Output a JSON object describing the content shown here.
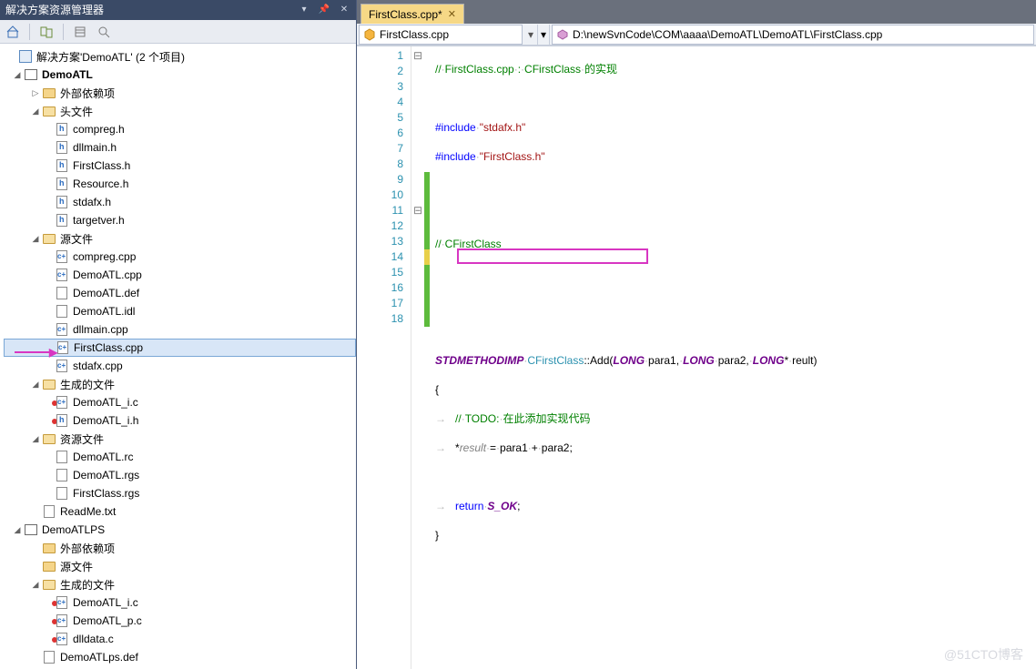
{
  "panelTitle": "解决方案资源管理器",
  "solution": "解决方案'DemoATL' (2 个项目)",
  "project1": "DemoATL",
  "p1_extdeps": "外部依赖项",
  "p1_headers": "头文件",
  "h_compreg": "compreg.h",
  "h_dllmain": "dllmain.h",
  "h_firstclass": "FirstClass.h",
  "h_resource": "Resource.h",
  "h_stdafx": "stdafx.h",
  "h_targetver": "targetver.h",
  "p1_sources": "源文件",
  "s_compreg": "compreg.cpp",
  "s_demoatl": "DemoATL.cpp",
  "s_demoatldef": "DemoATL.def",
  "s_demoatlidl": "DemoATL.idl",
  "s_dllmain": "dllmain.cpp",
  "s_firstclass": "FirstClass.cpp",
  "s_stdafx": "stdafx.cpp",
  "p1_generated": "生成的文件",
  "g1_ic": "DemoATL_i.c",
  "g1_ih": "DemoATL_i.h",
  "p1_resources": "资源文件",
  "r_rc": "DemoATL.rc",
  "r_rgs": "DemoATL.rgs",
  "r_fcrgs": "FirstClass.rgs",
  "readme": "ReadMe.txt",
  "project2": "DemoATLPS",
  "p2_extdeps": "外部依赖项",
  "p2_sources": "源文件",
  "p2_generated": "生成的文件",
  "g2_ic": "DemoATL_i.c",
  "g2_pc": "DemoATL_p.c",
  "g2_dlldata": "dlldata.c",
  "p2_psdef": "DemoATLps.def",
  "tabName": "FirstClass.cpp*",
  "navScope": "FirstClass.cpp",
  "filePath": "D:\\newSvnCode\\COM\\aaaa\\DemoATL\\DemoATL\\FirstClass.cpp",
  "code": {
    "l1a": "//",
    "l1b": "FirstClass.cpp",
    "l1c": ":",
    "l1d": "CFirstClass",
    "l1e": "的实现",
    "inc": "#include",
    "inc1": "\"stdafx.h\"",
    "inc2": "\"FirstClass.h\"",
    "l7a": "//",
    "l7b": "CFirstClass",
    "macro": "STDMETHODIMP",
    "cls": "CFirstClass",
    "method": "::Add(",
    "ltype": "LONG",
    "p1": "para1,",
    "p2": "para2,",
    "ptr": "*",
    "p3": "reult)",
    "lb": "{",
    "rb": "}",
    "todo1": "//",
    "todo2": "TODO:",
    "todo3": "在此添加实现代码",
    "res": "result",
    "expr": "para1",
    "plus": "+",
    "expr2": "para2;",
    "star": "*",
    "eq": "=",
    "ret": "return",
    "sok": "S_OK",
    "semi": ";"
  },
  "watermark": "@51CTO博客"
}
